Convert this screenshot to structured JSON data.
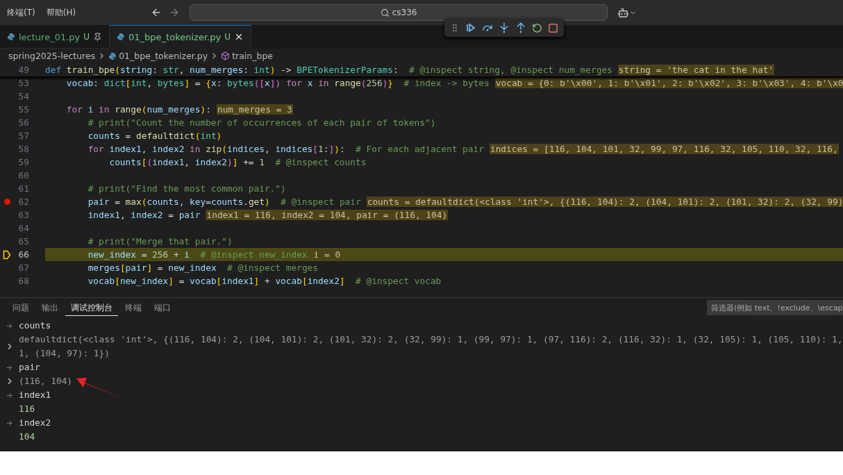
{
  "menu": [
    "终端(T)",
    "帮助(H)"
  ],
  "search": {
    "value": "cs336"
  },
  "tabs": [
    {
      "label": "lecture_01.py",
      "status": "U",
      "selected": false,
      "pinned": true
    },
    {
      "label": "01_bpe_tokenizer.py",
      "status": "U",
      "selected": true,
      "pinned": false
    }
  ],
  "breadcrumb": [
    {
      "label": "spring2025-lectures",
      "kind": "folder"
    },
    {
      "label": "01_bpe_tokenizer.py",
      "kind": "file"
    },
    {
      "label": "train_bpe",
      "kind": "symbol"
    }
  ],
  "sticky_line": {
    "number": "49",
    "code": [
      {
        "kind": "kw",
        "text": "def "
      },
      {
        "kind": "fn",
        "text": "train_bpe"
      },
      {
        "kind": "br",
        "text": "("
      },
      {
        "kind": "var",
        "text": "string"
      },
      {
        "kind": "p",
        "text": ": "
      },
      {
        "kind": "type",
        "text": "str"
      },
      {
        "kind": "p",
        "text": ", "
      },
      {
        "kind": "var",
        "text": "num_merges"
      },
      {
        "kind": "p",
        "text": ": "
      },
      {
        "kind": "type",
        "text": "int"
      },
      {
        "kind": "br",
        "text": ")"
      },
      {
        "kind": "p",
        "text": " -> "
      },
      {
        "kind": "type",
        "text": "BPETokenizerParams"
      },
      {
        "kind": "p",
        "text": ":"
      },
      {
        "kind": "cm",
        "text": "  # @inspect string, @inspect num_merges"
      }
    ],
    "inline_value": "string = 'the cat in the hat'"
  },
  "lines": [
    {
      "number": "53",
      "breakpoint": false,
      "current": false,
      "code": [
        {
          "kind": "var",
          "text": "    vocab"
        },
        {
          "kind": "p",
          "text": ": "
        },
        {
          "kind": "type",
          "text": "dict"
        },
        {
          "kind": "br",
          "text": "["
        },
        {
          "kind": "type",
          "text": "int"
        },
        {
          "kind": "p",
          "text": ", "
        },
        {
          "kind": "type",
          "text": "bytes"
        },
        {
          "kind": "br",
          "text": "]"
        },
        {
          "kind": "p",
          "text": " = "
        },
        {
          "kind": "br",
          "text": "{"
        },
        {
          "kind": "var",
          "text": "x"
        },
        {
          "kind": "p",
          "text": ": "
        },
        {
          "kind": "type",
          "text": "bytes"
        },
        {
          "kind": "br2",
          "text": "(["
        },
        {
          "kind": "var",
          "text": "x"
        },
        {
          "kind": "br2",
          "text": "])"
        },
        {
          "kind": "kw2",
          "text": " for "
        },
        {
          "kind": "var",
          "text": "x"
        },
        {
          "kind": "kw2",
          "text": " in "
        },
        {
          "kind": "fn",
          "text": "range"
        },
        {
          "kind": "br2",
          "text": "("
        },
        {
          "kind": "num",
          "text": "256"
        },
        {
          "kind": "br2",
          "text": ")"
        },
        {
          "kind": "br",
          "text": "}"
        },
        {
          "kind": "cm",
          "text": "  # index -> bytes"
        }
      ],
      "inline_value": "vocab = {0: b'\\x00', 1: b'\\x01', 2: b'\\x02', 3: b'\\x03', 4: b'\\x0"
    },
    {
      "number": "54",
      "breakpoint": false,
      "current": false
    },
    {
      "number": "55",
      "breakpoint": false,
      "current": false,
      "code": [
        {
          "kind": "kw2",
          "text": "    for "
        },
        {
          "kind": "var",
          "text": "i"
        },
        {
          "kind": "kw2",
          "text": " in "
        },
        {
          "kind": "fn",
          "text": "range"
        },
        {
          "kind": "br",
          "text": "("
        },
        {
          "kind": "var",
          "text": "num_merges"
        },
        {
          "kind": "br",
          "text": ")"
        },
        {
          "kind": "p",
          "text": ":"
        }
      ],
      "inline_value": "num_merges = 3"
    },
    {
      "number": "56",
      "breakpoint": false,
      "current": false,
      "code": [
        {
          "kind": "cm",
          "text": "        # print(\"Count the number of occurrences of each pair of tokens\")"
        }
      ]
    },
    {
      "number": "57",
      "breakpoint": false,
      "current": false,
      "code": [
        {
          "kind": "var",
          "text": "        counts"
        },
        {
          "kind": "p",
          "text": " = "
        },
        {
          "kind": "fn",
          "text": "defaultdict"
        },
        {
          "kind": "br",
          "text": "("
        },
        {
          "kind": "type",
          "text": "int"
        },
        {
          "kind": "br",
          "text": ")"
        }
      ]
    },
    {
      "number": "58",
      "breakpoint": false,
      "current": false,
      "code": [
        {
          "kind": "kw2",
          "text": "        for "
        },
        {
          "kind": "var",
          "text": "index1"
        },
        {
          "kind": "p",
          "text": ", "
        },
        {
          "kind": "var",
          "text": "index2"
        },
        {
          "kind": "kw2",
          "text": " in "
        },
        {
          "kind": "fn",
          "text": "zip"
        },
        {
          "kind": "br",
          "text": "("
        },
        {
          "kind": "var",
          "text": "indices"
        },
        {
          "kind": "p",
          "text": ", "
        },
        {
          "kind": "var",
          "text": "indices"
        },
        {
          "kind": "br2",
          "text": "["
        },
        {
          "kind": "num",
          "text": "1"
        },
        {
          "kind": "p",
          "text": ":"
        },
        {
          "kind": "br2",
          "text": "]"
        },
        {
          "kind": "br",
          "text": ")"
        },
        {
          "kind": "p",
          "text": ":"
        },
        {
          "kind": "cm",
          "text": "  # For each adjacent pair"
        }
      ],
      "inline_value": "indices = [116, 104, 101, 32, 99, 97, 116, 32, 105, 110, 32, 116,"
    },
    {
      "number": "59",
      "breakpoint": false,
      "current": false,
      "code": [
        {
          "kind": "var",
          "text": "            counts"
        },
        {
          "kind": "br",
          "text": "["
        },
        {
          "kind": "br2",
          "text": "("
        },
        {
          "kind": "var",
          "text": "index1"
        },
        {
          "kind": "p",
          "text": ", "
        },
        {
          "kind": "var",
          "text": "index2"
        },
        {
          "kind": "br2",
          "text": ")"
        },
        {
          "kind": "br",
          "text": "]"
        },
        {
          "kind": "p",
          "text": " += "
        },
        {
          "kind": "num",
          "text": "1"
        },
        {
          "kind": "cm",
          "text": "  # @inspect counts"
        }
      ]
    },
    {
      "number": "60",
      "breakpoint": false,
      "current": false
    },
    {
      "number": "61",
      "breakpoint": false,
      "current": false,
      "code": [
        {
          "kind": "cm",
          "text": "        # print(\"Find the most common pair.\")"
        }
      ]
    },
    {
      "number": "62",
      "breakpoint": true,
      "current": false,
      "code": [
        {
          "kind": "var",
          "text": "        pair"
        },
        {
          "kind": "p",
          "text": " = "
        },
        {
          "kind": "fn",
          "text": "max"
        },
        {
          "kind": "br",
          "text": "("
        },
        {
          "kind": "var",
          "text": "counts"
        },
        {
          "kind": "p",
          "text": ", "
        },
        {
          "kind": "var",
          "text": "key"
        },
        {
          "kind": "p",
          "text": "="
        },
        {
          "kind": "var",
          "text": "counts"
        },
        {
          "kind": "p",
          "text": "."
        },
        {
          "kind": "fn",
          "text": "get"
        },
        {
          "kind": "br",
          "text": ")"
        },
        {
          "kind": "cm",
          "text": "  # @inspect pair"
        }
      ],
      "inline_value": "counts = defaultdict(<class 'int'>, {(116, 104): 2, (104, 101): 2, (101, 32): 2, (32, 99)"
    },
    {
      "number": "63",
      "breakpoint": false,
      "current": false,
      "code": [
        {
          "kind": "var",
          "text": "        index1"
        },
        {
          "kind": "p",
          "text": ", "
        },
        {
          "kind": "var",
          "text": "index2"
        },
        {
          "kind": "p",
          "text": " = "
        },
        {
          "kind": "var",
          "text": "pair"
        }
      ],
      "inline_value": "index1 = 116, index2 = 104, pair = (116, 104)"
    },
    {
      "number": "64",
      "breakpoint": false,
      "current": false
    },
    {
      "number": "65",
      "breakpoint": false,
      "current": false,
      "code": [
        {
          "kind": "cm",
          "text": "        # print(\"Merge that pair.\")"
        }
      ]
    },
    {
      "number": "66",
      "breakpoint": false,
      "current": true,
      "code": [
        {
          "kind": "var",
          "text": "        new_index"
        },
        {
          "kind": "p",
          "text": " = "
        },
        {
          "kind": "num",
          "text": "256"
        },
        {
          "kind": "p",
          "text": " + "
        },
        {
          "kind": "var",
          "text": "i"
        },
        {
          "kind": "cm",
          "text": "  # @inspect new_index"
        }
      ],
      "inline_value": "i = 0"
    },
    {
      "number": "67",
      "breakpoint": false,
      "current": false,
      "code": [
        {
          "kind": "var",
          "text": "        merges"
        },
        {
          "kind": "br",
          "text": "["
        },
        {
          "kind": "var",
          "text": "pair"
        },
        {
          "kind": "br",
          "text": "]"
        },
        {
          "kind": "p",
          "text": " = "
        },
        {
          "kind": "var",
          "text": "new_index"
        },
        {
          "kind": "cm",
          "text": "  # @inspect merges"
        }
      ]
    },
    {
      "number": "68",
      "breakpoint": false,
      "current": false,
      "code": [
        {
          "kind": "var",
          "text": "        vocab"
        },
        {
          "kind": "br",
          "text": "["
        },
        {
          "kind": "var",
          "text": "new_index"
        },
        {
          "kind": "br",
          "text": "]"
        },
        {
          "kind": "p",
          "text": " = "
        },
        {
          "kind": "var",
          "text": "vocab"
        },
        {
          "kind": "br",
          "text": "["
        },
        {
          "kind": "var",
          "text": "index1"
        },
        {
          "kind": "br",
          "text": "]"
        },
        {
          "kind": "p",
          "text": " + "
        },
        {
          "kind": "var",
          "text": "vocab"
        },
        {
          "kind": "br",
          "text": "["
        },
        {
          "kind": "var",
          "text": "index2"
        },
        {
          "kind": "br",
          "text": "]"
        },
        {
          "kind": "cm",
          "text": "  # @inspect vocab"
        }
      ]
    }
  ],
  "panel_tabs": [
    {
      "label": "问题",
      "selected": false
    },
    {
      "label": "输出",
      "selected": false
    },
    {
      "label": "调试控制台",
      "selected": true
    },
    {
      "label": "终端",
      "selected": false
    },
    {
      "label": "端口",
      "selected": false
    }
  ],
  "filter": {
    "placeholder": "筛选器(例如 text、!exclude、\\escap"
  },
  "console": [
    {
      "kind": "input",
      "lines": [
        "counts"
      ]
    },
    {
      "kind": "object",
      "lines": [
        "defaultdict(<class 'int'>, {(116, 104): 2, (104, 101): 2, (101, 32): 2, (32, 99): 1, (99, 97): 1, (97, 116): 2, (116, 32): 1, (32, 105): 1, (105, 110): 1,",
        "1, (104, 97): 1})"
      ]
    },
    {
      "kind": "input",
      "lines": [
        "pair"
      ]
    },
    {
      "kind": "object",
      "lines": [
        "(116, 104)"
      ]
    },
    {
      "kind": "input",
      "lines": [
        "index1"
      ]
    },
    {
      "kind": "number",
      "lines": [
        "116"
      ]
    },
    {
      "kind": "input",
      "lines": [
        "index2"
      ]
    },
    {
      "kind": "number",
      "lines": [
        "104"
      ]
    }
  ]
}
